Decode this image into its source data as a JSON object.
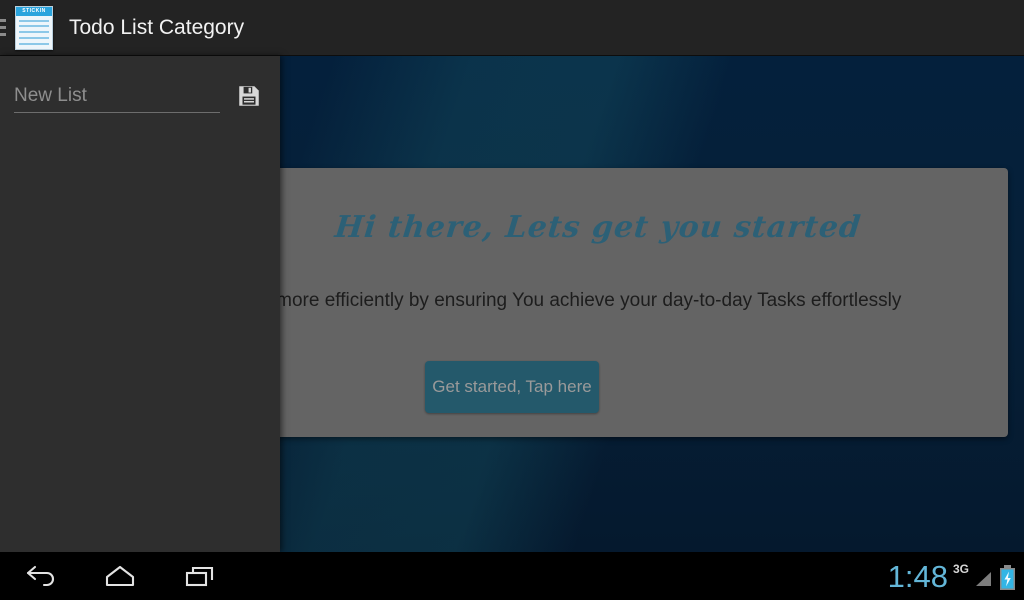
{
  "actionbar": {
    "menu_icon": "hamburger-menu-icon",
    "app_icon": {
      "name": "sticky-notes-app-icon",
      "cap_label": "STICKIN"
    },
    "title": "Todo List Category"
  },
  "drawer": {
    "new_list_value": "",
    "new_list_placeholder": "New List",
    "save_icon": "floppy-disk-save-icon"
  },
  "welcome": {
    "heading": "Hi there, Lets get you started",
    "body": "life more efficiently by ensuring You achieve your day-to-day Tasks effortlessly",
    "button_label": "Get started, Tap here"
  },
  "navbar": {
    "back_label": "Back",
    "home_label": "Home",
    "recents_label": "Recent apps",
    "clock": "1:48",
    "network": "3G",
    "signal_icon": "signal-strength-icon",
    "battery_icon": "battery-charging-icon"
  },
  "colors": {
    "actionbar_bg": "#232323",
    "drawer_bg": "#2e2e2e",
    "card_bg": "#646464",
    "wallpaper": "#062038",
    "accent_teal": "#24596b",
    "heading_teal": "#2c6076",
    "clock_blue": "#63b6d8",
    "battery_blue": "#33b5e5"
  }
}
